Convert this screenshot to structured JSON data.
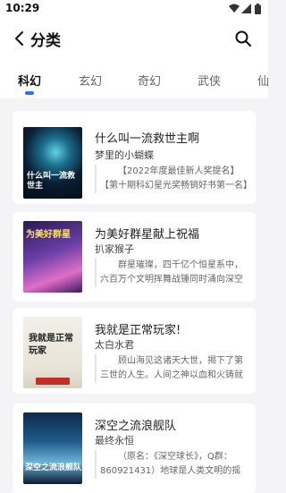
{
  "status": {
    "time": "10:29"
  },
  "header": {
    "title": "分类"
  },
  "tabs": [
    {
      "label": "科幻"
    },
    {
      "label": "玄幻"
    },
    {
      "label": "奇幻"
    },
    {
      "label": "武侠"
    },
    {
      "label": "仙"
    }
  ],
  "books": [
    {
      "title": "什么叫一流救世主啊",
      "author": "梦里的小蝴蝶",
      "desc": "【2022年度最佳新人奖提名】【第十期科幻星光奖畅销好书第一名】",
      "cover_text": "什么叫一流救世主"
    },
    {
      "title": "为美好群星献上祝福",
      "author": "扒家猴子",
      "desc": "群星璀璨，四千亿个恒星系中，六百万个文明挥舞战锤同时涌向深空",
      "cover_text": "为美好群星"
    },
    {
      "title": "我就是正常玩家!",
      "author": "太白水君",
      "desc": "顾山海见这诸天大世，揭下了第三世的人生。人间之神以血和火铸就",
      "cover_text": "我就是正常玩家"
    },
    {
      "title": "深空之流浪舰队",
      "author": "最终永恒",
      "desc": "（原名：《深空球长》，Q群：860921431）地球是人类文明的摇篮",
      "cover_text": "深空之流浪舰队"
    }
  ]
}
